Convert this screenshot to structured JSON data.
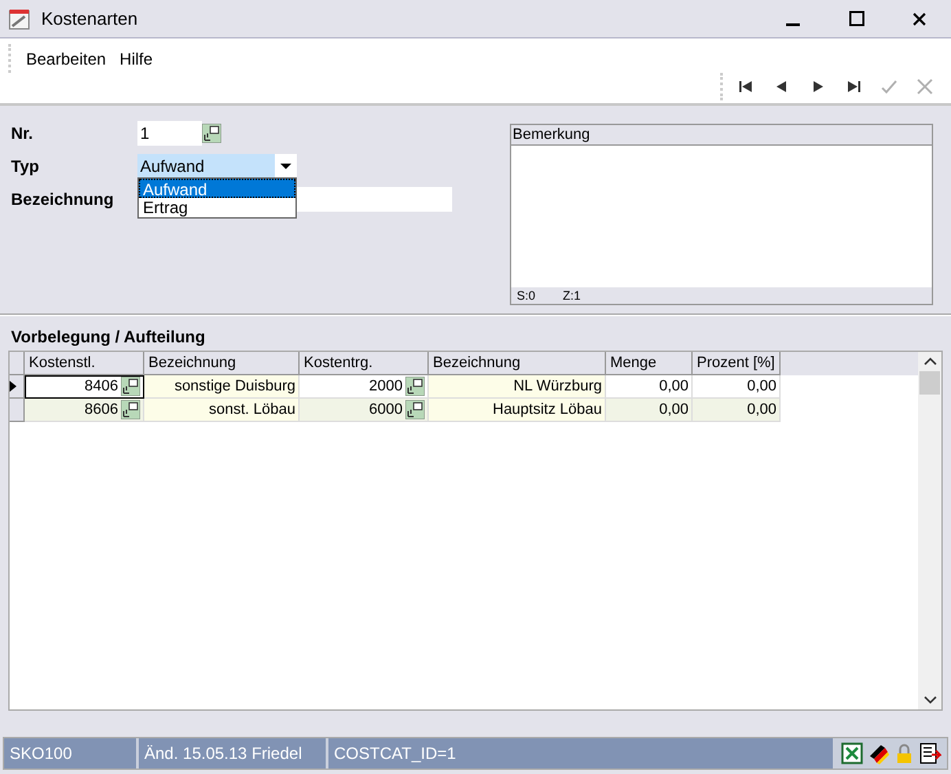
{
  "window": {
    "title": "Kostenarten"
  },
  "menu": [
    {
      "label": "Bearbeiten"
    },
    {
      "label": "Hilfe"
    }
  ],
  "nav_buttons": [
    {
      "kind": "first",
      "disabled": false
    },
    {
      "kind": "prev",
      "disabled": false
    },
    {
      "kind": "next",
      "disabled": false
    },
    {
      "kind": "last",
      "disabled": false
    },
    {
      "kind": "save",
      "disabled": true
    },
    {
      "kind": "cancel",
      "disabled": true
    }
  ],
  "form": {
    "nr": {
      "label": "Nr.",
      "value": "1"
    },
    "typ": {
      "label": "Typ",
      "value": "Aufwand",
      "expanded": true,
      "options": [
        {
          "label": "Aufwand",
          "selected": true
        },
        {
          "label": "Ertrag",
          "selected": false
        }
      ]
    },
    "bezeichnung": {
      "label": "Bezeichnung"
    }
  },
  "bemerkung": {
    "title": "Bemerkung",
    "status": [
      "S:0",
      "Z:1"
    ]
  },
  "grid": {
    "title": "Vorbelegung / Aufteilung",
    "columns": [
      "Kostenstl.",
      "Bezeichnung",
      "Kostentrg.",
      "Bezeichnung",
      "Menge",
      "Prozent [%]"
    ],
    "rows": [
      {
        "current": true,
        "cells": [
          "8406",
          "sonstige Duisburg",
          "2000",
          "NL Würzburg",
          "0,00",
          "0,00"
        ]
      },
      {
        "current": false,
        "cells": [
          "8606",
          "sonst. Löbau",
          "6000",
          "Hauptsitz Löbau",
          "0,00",
          "0,00"
        ]
      }
    ]
  },
  "status_bar": [
    "SKO100",
    "Änd. 15.05.13 Friedel",
    "COSTCAT_ID=1"
  ]
}
